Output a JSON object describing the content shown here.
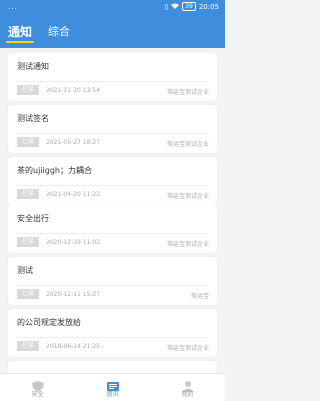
{
  "status": {
    "left": "...",
    "battery": "39",
    "time": "20:05"
  },
  "tabs": [
    {
      "label": "通知"
    },
    {
      "label": "综合"
    }
  ],
  "notices": [
    {
      "title": "测试通知",
      "badge": "已读",
      "time": "2021-11-10 13:54",
      "org": "驾运宝测试企业"
    },
    {
      "title": "测试签名",
      "badge": "已读",
      "time": "2021-05-27 18:27",
      "org": "驾运宝测试企业"
    },
    {
      "title": "茶的ujiiggh；力耦合",
      "badge": "已读",
      "time": "2021-04-20 11:22",
      "org": "驾运宝测试企业"
    },
    {
      "title": "安全出行",
      "badge": "已读",
      "time": "2020-12-19 11:02",
      "org": "驾运宝测试企业"
    },
    {
      "title": "测试",
      "badge": "已读",
      "time": "2020-12-11 15:27",
      "org": "驾运宝"
    },
    {
      "title": "的公司规定发放给",
      "badge": "已读",
      "time": "2018-06-14 21:25",
      "org": "驾运宝测试企业"
    }
  ],
  "tabbar": [
    {
      "label": "安全"
    },
    {
      "label": "资讯"
    },
    {
      "label": "我的"
    }
  ],
  "colors": {
    "primary": "#3f8ede",
    "accent": "#ffd400"
  }
}
